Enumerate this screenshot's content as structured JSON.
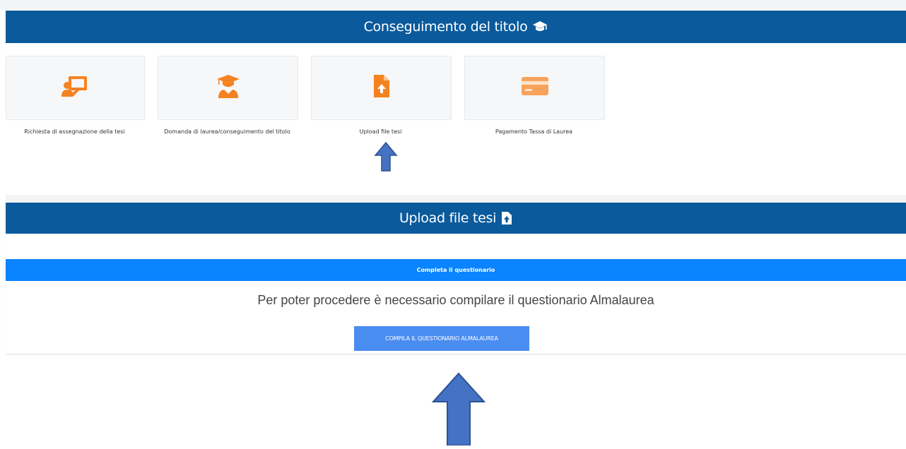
{
  "section_header": {
    "title": "Conseguimento del titolo",
    "icon": "graduation-cap-icon"
  },
  "tiles": [
    {
      "label": "Richiesta di assegnazione della tesi",
      "icon": "teacher-board-icon"
    },
    {
      "label": "Domanda di laurea/conseguimento del titolo",
      "icon": "graduate-icon"
    },
    {
      "label": "Upload file tesi",
      "icon": "file-upload-icon"
    },
    {
      "label": "Pagamento Tassa di Laurea",
      "icon": "credit-card-icon"
    }
  ],
  "upload_header": {
    "title": "Upload file tesi",
    "icon": "file-upload-icon"
  },
  "questionnaire": {
    "bar_title": "Completa il questionario",
    "message": "Per poter procedere è necessario compilare il questionario Almalaurea",
    "button_label": "COMPILA IL QUESTIONARIO ALMALAUREA"
  },
  "colors": {
    "header": "#0a5a9c",
    "subbar": "#0a84ff",
    "button": "#4a8df1",
    "icon_orange": "#f58220",
    "arrow": "#4472c4"
  }
}
